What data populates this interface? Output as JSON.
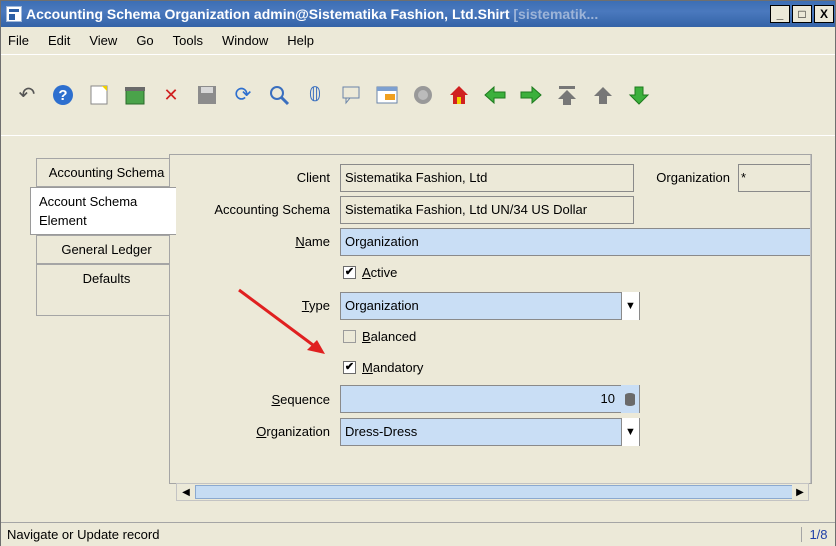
{
  "window": {
    "title_main": "Accounting Schema  Organization  admin@Sistematika Fashion, Ltd.Shirt ",
    "title_faded": "[sistematik...",
    "buttons": {
      "minimize": "_",
      "maximize": "□",
      "close": "X"
    }
  },
  "menu": [
    "File",
    "Edit",
    "View",
    "Go",
    "Tools",
    "Window",
    "Help"
  ],
  "toolbar": {
    "icons": [
      "undo-icon",
      "help-icon",
      "new-record-icon",
      "copy-record-icon",
      "delete-icon",
      "save-icon",
      "refresh-icon",
      "find-icon",
      "attachment-icon",
      "chat-icon",
      "grid-toggle-icon",
      "history-icon",
      "home-icon",
      "back-icon",
      "forward-icon",
      "first-record-icon",
      "previous-record-icon",
      "next-record-icon"
    ]
  },
  "tabs": [
    "Accounting Schema",
    "Account Schema Element",
    "General Ledger",
    "Defaults"
  ],
  "active_tab": "Account Schema Element",
  "form": {
    "client_label": "Client",
    "client_value": "Sistematika Fashion, Ltd",
    "organization_top_label": "Organization",
    "organization_top_value": "*",
    "acct_schema_label": "Accounting Schema",
    "acct_schema_value": "Sistematika Fashion, Ltd UN/34 US Dollar",
    "name_label": "Name",
    "name_value": "Organization",
    "active_label": "Active",
    "active_checked": true,
    "type_label": "Type",
    "type_value": "Organization",
    "balanced_label": "Balanced",
    "balanced_checked": false,
    "mandatory_label": "Mandatory",
    "mandatory_checked": true,
    "sequence_label": "Sequence",
    "sequence_value": "10",
    "org_label": "Organization",
    "org_value": "Dress-Dress"
  },
  "status": {
    "text": "Navigate or Update record",
    "record_count": "1/8"
  },
  "colors": {
    "titlebar": "#3c6eb4",
    "field_editable": "#c9def5",
    "annotation_arrow": "#e02020"
  }
}
